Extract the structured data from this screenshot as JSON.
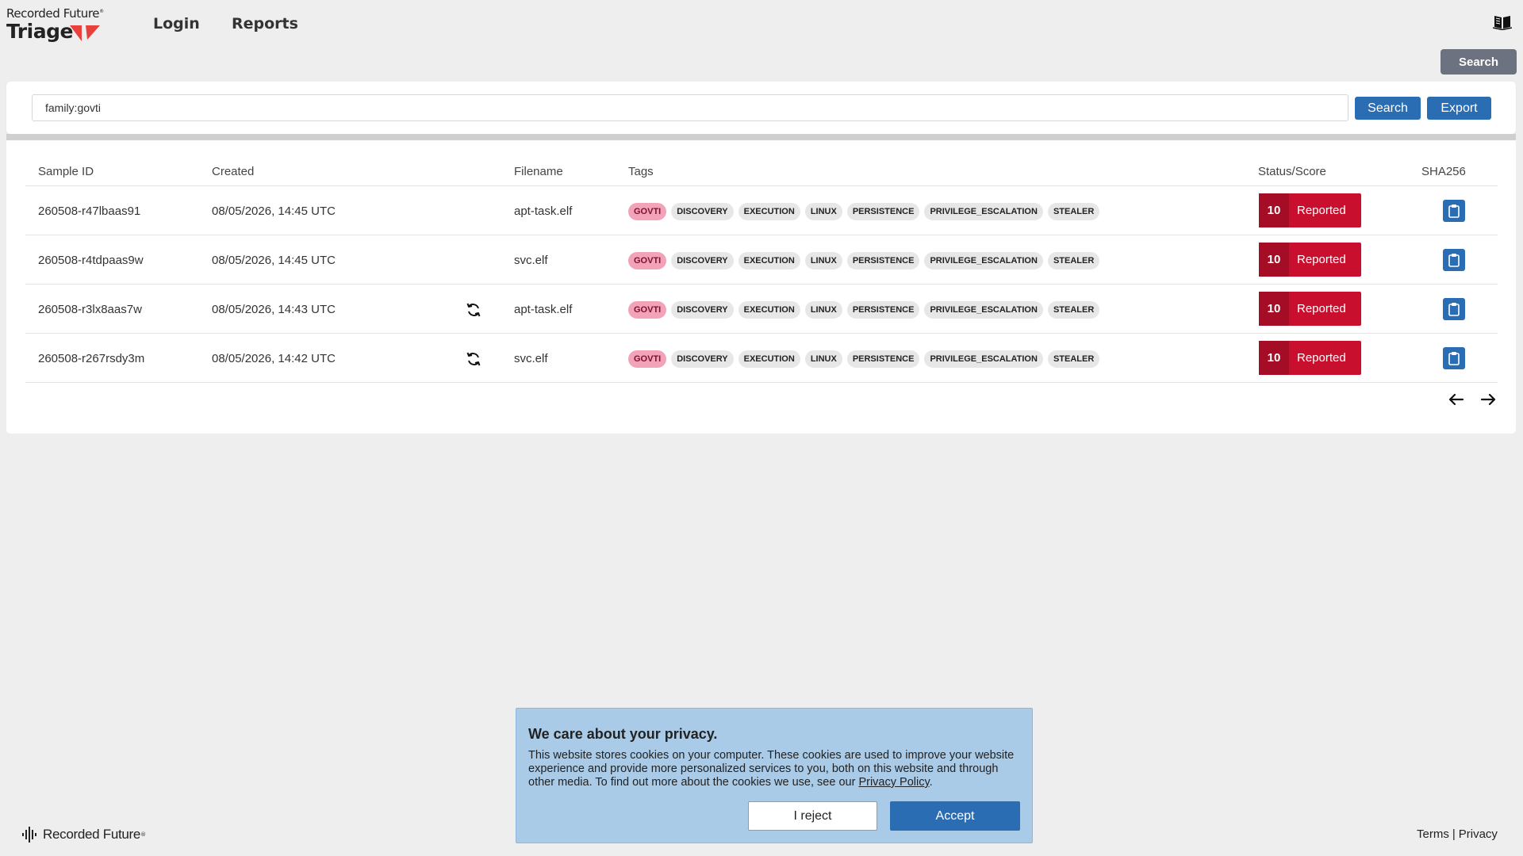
{
  "header": {
    "logo_top": "Recorded Future",
    "logo_bottom": "Triage",
    "nav_login": "Login",
    "nav_reports": "Reports",
    "search_toggle": "Search"
  },
  "search": {
    "query": "family:govti",
    "search_label": "Search",
    "export_label": "Export"
  },
  "table": {
    "headers": {
      "sample_id": "Sample ID",
      "created": "Created",
      "filename": "Filename",
      "tags": "Tags",
      "status": "Status/Score",
      "sha": "SHA256"
    },
    "rows": [
      {
        "id": "260508-r47lbaas91",
        "created": "08/05/2026, 14:45 UTC",
        "filename": "apt-task.elf",
        "score": "10",
        "status": "Reported",
        "tags": [
          "GOVTI",
          "DISCOVERY",
          "EXECUTION",
          "LINUX",
          "PERSISTENCE",
          "PRIVILEGE_ESCALATION",
          "STEALER"
        ]
      },
      {
        "id": "260508-r4tdpaas9w",
        "created": "08/05/2026, 14:45 UTC",
        "filename": "svc.elf",
        "score": "10",
        "status": "Reported",
        "tags": [
          "GOVTI",
          "DISCOVERY",
          "EXECUTION",
          "LINUX",
          "PERSISTENCE",
          "PRIVILEGE_ESCALATION",
          "STEALER"
        ]
      },
      {
        "id": "260508-r3lx8aas7w",
        "created": "08/05/2026, 14:43 UTC",
        "filename": "apt-task.elf",
        "score": "10",
        "status": "Reported",
        "tags": [
          "GOVTI",
          "DISCOVERY",
          "EXECUTION",
          "LINUX",
          "PERSISTENCE",
          "PRIVILEGE_ESCALATION",
          "STEALER"
        ]
      },
      {
        "id": "260508-r267rsdy3m",
        "created": "08/05/2026, 14:42 UTC",
        "filename": "svc.elf",
        "score": "10",
        "status": "Reported",
        "tags": [
          "GOVTI",
          "DISCOVERY",
          "EXECUTION",
          "LINUX",
          "PERSISTENCE",
          "PRIVILEGE_ESCALATION",
          "STEALER"
        ]
      }
    ]
  },
  "cookie": {
    "title": "We care about your privacy.",
    "body_1": "This website stores cookies on your computer. These cookies are used to improve your website experience and provide more personalized services to you, both on this website and through other media. To find out more about the cookies we use, see our ",
    "policy_link": "Privacy Policy",
    "body_2": ".",
    "reject": "I reject",
    "accept": "Accept"
  },
  "footer": {
    "brand": "Recorded Future",
    "terms": "Terms",
    "separator": "|",
    "privacy": "Privacy"
  },
  "colors": {
    "accent_blue": "#2a6db3",
    "status_red": "#c8102e",
    "family_tag_pink": "#f3a3b8",
    "cookie_bg": "#a9cbe7"
  }
}
